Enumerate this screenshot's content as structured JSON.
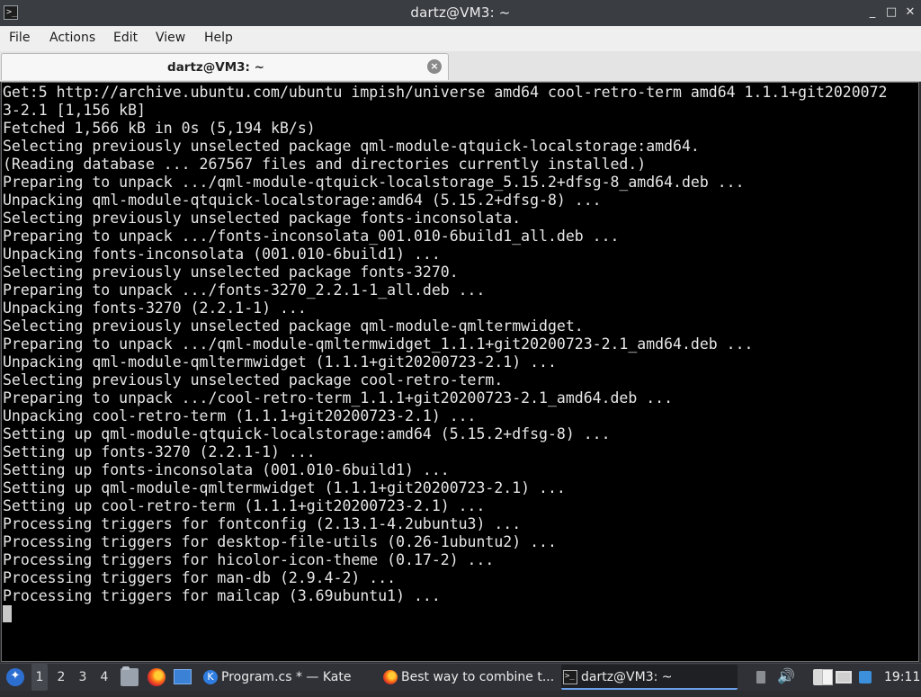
{
  "window": {
    "title": "dartz@VM3: ~",
    "buttons": {
      "minimize": "_",
      "maximize": "□",
      "close": "✕"
    }
  },
  "menu": [
    "File",
    "Actions",
    "Edit",
    "View",
    "Help"
  ],
  "tab": {
    "label": "dartz@VM3: ~"
  },
  "terminal": {
    "lines": [
      "Get:5 http://archive.ubuntu.com/ubuntu impish/universe amd64 cool-retro-term amd64 1.1.1+git2020072",
      "3-2.1 [1,156 kB]",
      "Fetched 1,566 kB in 0s (5,194 kB/s)",
      "Selecting previously unselected package qml-module-qtquick-localstorage:amd64.",
      "(Reading database ... 267567 files and directories currently installed.)",
      "Preparing to unpack .../qml-module-qtquick-localstorage_5.15.2+dfsg-8_amd64.deb ...",
      "Unpacking qml-module-qtquick-localstorage:amd64 (5.15.2+dfsg-8) ...",
      "Selecting previously unselected package fonts-inconsolata.",
      "Preparing to unpack .../fonts-inconsolata_001.010-6build1_all.deb ...",
      "Unpacking fonts-inconsolata (001.010-6build1) ...",
      "Selecting previously unselected package fonts-3270.",
      "Preparing to unpack .../fonts-3270_2.2.1-1_all.deb ...",
      "Unpacking fonts-3270 (2.2.1-1) ...",
      "Selecting previously unselected package qml-module-qmltermwidget.",
      "Preparing to unpack .../qml-module-qmltermwidget_1.1.1+git20200723-2.1_amd64.deb ...",
      "Unpacking qml-module-qmltermwidget (1.1.1+git20200723-2.1) ...",
      "Selecting previously unselected package cool-retro-term.",
      "Preparing to unpack .../cool-retro-term_1.1.1+git20200723-2.1_amd64.deb ...",
      "Unpacking cool-retro-term (1.1.1+git20200723-2.1) ...",
      "Setting up qml-module-qtquick-localstorage:amd64 (5.15.2+dfsg-8) ...",
      "Setting up fonts-3270 (2.2.1-1) ...",
      "Setting up fonts-inconsolata (001.010-6build1) ...",
      "Setting up qml-module-qmltermwidget (1.1.1+git20200723-2.1) ...",
      "Setting up cool-retro-term (1.1.1+git20200723-2.1) ...",
      "Processing triggers for fontconfig (2.13.1-4.2ubuntu3) ...",
      "Processing triggers for desktop-file-utils (0.26-1ubuntu2) ...",
      "Processing triggers for hicolor-icon-theme (0.17-2) ...",
      "Processing triggers for man-db (2.9.4-2) ...",
      "Processing triggers for mailcap (3.69ubuntu1) ..."
    ]
  },
  "taskbar": {
    "workspaces": [
      "1",
      "2",
      "3",
      "4"
    ],
    "active_workspace": "1",
    "tasks": [
      {
        "label": "Program.cs * — Kate",
        "icon": "kate-icon"
      },
      {
        "label": "Best way to combine t...",
        "icon": "firefox-icon"
      },
      {
        "label": "dartz@VM3: ~",
        "icon": "terminal-icon"
      }
    ],
    "clock": "19:11"
  }
}
